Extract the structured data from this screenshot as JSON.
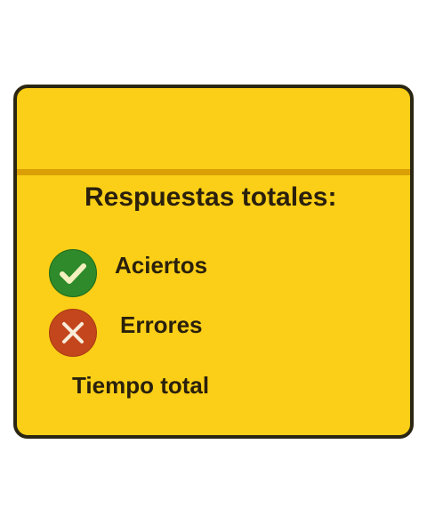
{
  "panel": {
    "title": "Respuestas totales:",
    "items": [
      {
        "label": "Aciertos",
        "icon": "check-icon",
        "color": "#2e8a2a"
      },
      {
        "label": "Errores",
        "icon": "x-icon",
        "color": "#c4461c"
      }
    ],
    "time_label": "Tiempo total"
  }
}
